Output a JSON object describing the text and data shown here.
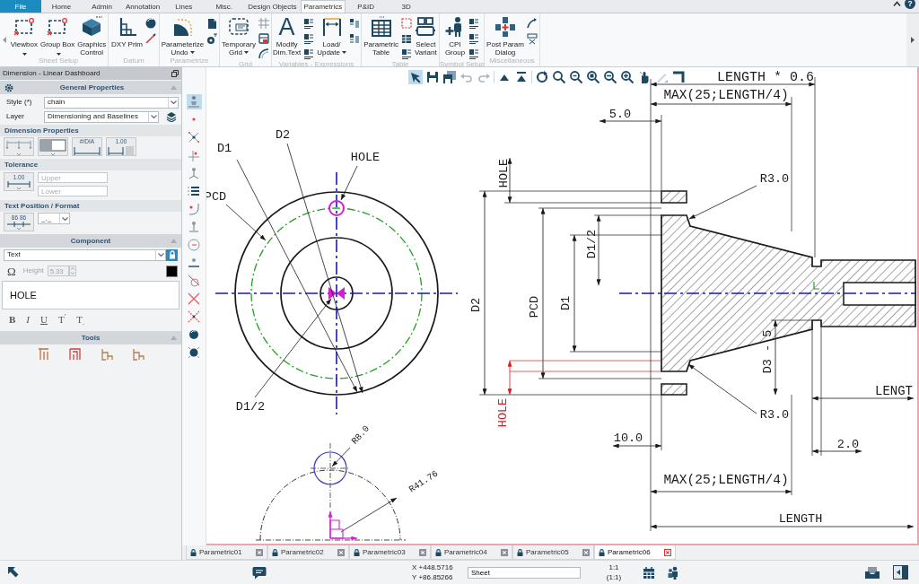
{
  "ribbon": {
    "tabs": [
      {
        "label": "File",
        "kind": "file",
        "selected": false
      },
      {
        "label": "Home",
        "kind": "tab",
        "selected": false
      },
      {
        "label": "Admin",
        "kind": "tab",
        "selected": false
      },
      {
        "label": "Annotation",
        "kind": "tab",
        "selected": false
      },
      {
        "label": "Lines",
        "kind": "tab",
        "selected": false
      },
      {
        "label": "Misc.",
        "kind": "tab",
        "selected": false
      },
      {
        "label": "Design Objects",
        "kind": "tab",
        "selected": false
      },
      {
        "label": "Parametrics",
        "kind": "tab",
        "selected": true
      },
      {
        "label": "P&ID",
        "kind": "tab",
        "selected": false
      },
      {
        "label": "3D",
        "kind": "tab",
        "selected": false
      }
    ],
    "help": "?",
    "groups": [
      {
        "label": "Sheet Setup",
        "buttons": [
          {
            "label": "Viewbox",
            "dropdown": true
          },
          {
            "label": "Group Box",
            "dropdown": true
          },
          {
            "label": "Graphics\nControl",
            "dropdown": false
          }
        ]
      },
      {
        "label": "Datum",
        "buttons": [
          {
            "label": "DXY Prim",
            "dropdown": false
          }
        ]
      },
      {
        "label": "Parametrize",
        "buttons": [
          {
            "label": "Parameterize\nUndo",
            "dropdown": true
          }
        ]
      },
      {
        "label": "Grid",
        "buttons": [
          {
            "label": "Temporary\nGrid",
            "dropdown": true
          }
        ]
      },
      {
        "label": "Variables - Expressions",
        "buttons": [
          {
            "label": "Modify\nDim.Text",
            "glyph": "A",
            "dropdown": false
          },
          {
            "label": "Load/\nUpdate",
            "dropdown": true
          }
        ]
      },
      {
        "label": "Table",
        "buttons": [
          {
            "label": "Parametric\nTable",
            "dropdown": false
          },
          {
            "label": "Select\nVariant",
            "dropdown": false
          }
        ]
      },
      {
        "label": "Symbol Setup",
        "buttons": [
          {
            "label": "CPI\nGroup",
            "dropdown": false
          }
        ]
      },
      {
        "label": "Miscellaneous",
        "buttons": [
          {
            "label": "Post Param\nDialog",
            "dropdown": false
          }
        ]
      }
    ]
  },
  "dashboard": {
    "title": "Dimension - Linear Dashboard",
    "general": {
      "title": "General Properties",
      "expanded": true,
      "fields": [
        {
          "label": "Style (*)",
          "value": "chain"
        },
        {
          "label": "Layer",
          "value": "Dimensioning and Baselines"
        }
      ]
    },
    "dimension_properties": {
      "title": "Dimension Properties",
      "buttons": [
        {
          "kind": "chain"
        },
        {
          "kind": "fill"
        },
        {
          "kind": "diameter",
          "caption": "#/DIA"
        },
        {
          "kind": "value",
          "caption": "1.00"
        }
      ]
    },
    "tolerance": {
      "title": "Tolerance",
      "button": {
        "caption": "1.00"
      },
      "fields": [
        {
          "placeholder": "Upper"
        },
        {
          "placeholder": "Lower"
        }
      ]
    },
    "text_position": {
      "title": "Text Position / Format",
      "button": {
        "caption": "86 86"
      },
      "format": {
        "value": "_._"
      }
    },
    "component": {
      "title": "Component",
      "expanded": true,
      "type": {
        "value": "Text"
      },
      "locked": true,
      "symbol": "Ω",
      "height": {
        "label": "Height",
        "value": "5.33",
        "disabled": true
      },
      "text": "HOLE",
      "format_buttons": [
        {
          "label": "B",
          "kind": "bold"
        },
        {
          "label": "I",
          "kind": "italic"
        },
        {
          "label": "U",
          "kind": "underline"
        },
        {
          "label": "T$^{'}$",
          "kind": "superscript"
        },
        {
          "label": "T$_{.}$",
          "kind": "subscript"
        }
      ]
    },
    "tools": {
      "title": "Tools",
      "expanded": true
    }
  },
  "snap_toolbar": [
    {
      "selected": true
    },
    {
      "selected": false
    },
    {
      "selected": false
    },
    {
      "selected": false
    },
    {
      "selected": false
    },
    {
      "selected": false
    },
    {
      "selected": false
    },
    {
      "selected": false
    },
    {
      "selected": false
    },
    {
      "selected": false
    },
    {
      "selected": false
    },
    {
      "selected": false
    },
    {
      "selected": false
    },
    {
      "selected": false
    },
    {
      "selected": false
    }
  ],
  "canvas_toolbar": [
    {
      "selected": true,
      "disabled": false
    },
    {
      "selected": false,
      "disabled": false
    },
    {
      "selected": false,
      "disabled": false
    },
    {
      "selected": false,
      "disabled": true
    },
    {
      "selected": false,
      "disabled": true
    },
    {
      "selected": false,
      "disabled": false
    },
    {
      "selected": false,
      "disabled": false
    },
    {
      "selected": false,
      "disabled": false
    },
    {
      "selected": false,
      "disabled": false
    },
    {
      "selected": false,
      "disabled": false
    },
    {
      "selected": false,
      "disabled": false
    },
    {
      "selected": false,
      "disabled": false
    },
    {
      "selected": false,
      "disabled": false
    },
    {
      "selected": false,
      "disabled": false
    },
    {
      "selected": false,
      "disabled": true
    },
    {
      "selected": false,
      "disabled": false
    }
  ],
  "drawing": {
    "front_labels": [
      "D1",
      "D2",
      "HOLE",
      "PCD",
      "D1/2"
    ],
    "detail_labels": [
      "R8.0",
      "R41.76"
    ],
    "section_labels": [
      {
        "text": "LENGTH * 0.6",
        "highlighted": false
      },
      {
        "text": "MAX(25;LENGTH/4)",
        "highlighted": false
      },
      {
        "text": "5.0",
        "highlighted": false
      },
      {
        "text": "HOLE",
        "highlighted": false
      },
      {
        "text": "R3.0",
        "highlighted": false
      },
      {
        "text": "D2",
        "highlighted": false
      },
      {
        "text": "PCD",
        "highlighted": false
      },
      {
        "text": "D1",
        "highlighted": false
      },
      {
        "text": "D1/2",
        "highlighted": false
      },
      {
        "text": "D3 - 5",
        "highlighted": false
      },
      {
        "text": "HOLE",
        "highlighted": true
      },
      {
        "text": "R3.0",
        "highlighted": false
      },
      {
        "text": "10.0",
        "highlighted": false
      },
      {
        "text": "2.0",
        "highlighted": false
      },
      {
        "text": "MAX(25;LENGTH/4)",
        "highlighted": false
      },
      {
        "text": "LENGTH",
        "highlighted": false
      },
      {
        "text": "LENGT",
        "highlighted": false
      }
    ]
  },
  "sheet_tabs": [
    {
      "label": "Parametric01",
      "selected": false
    },
    {
      "label": "Parametric02",
      "selected": false
    },
    {
      "label": "Parametric03",
      "selected": false
    },
    {
      "label": "Parametric04",
      "selected": false
    },
    {
      "label": "Parametric05",
      "selected": false
    },
    {
      "label": "Parametric06",
      "selected": true
    }
  ],
  "status_bar": {
    "x": "X +448.5716",
    "y": "Y +86.85266",
    "sheet": "Sheet",
    "scale": "1:1",
    "scale_ratio": "(1:1)"
  }
}
